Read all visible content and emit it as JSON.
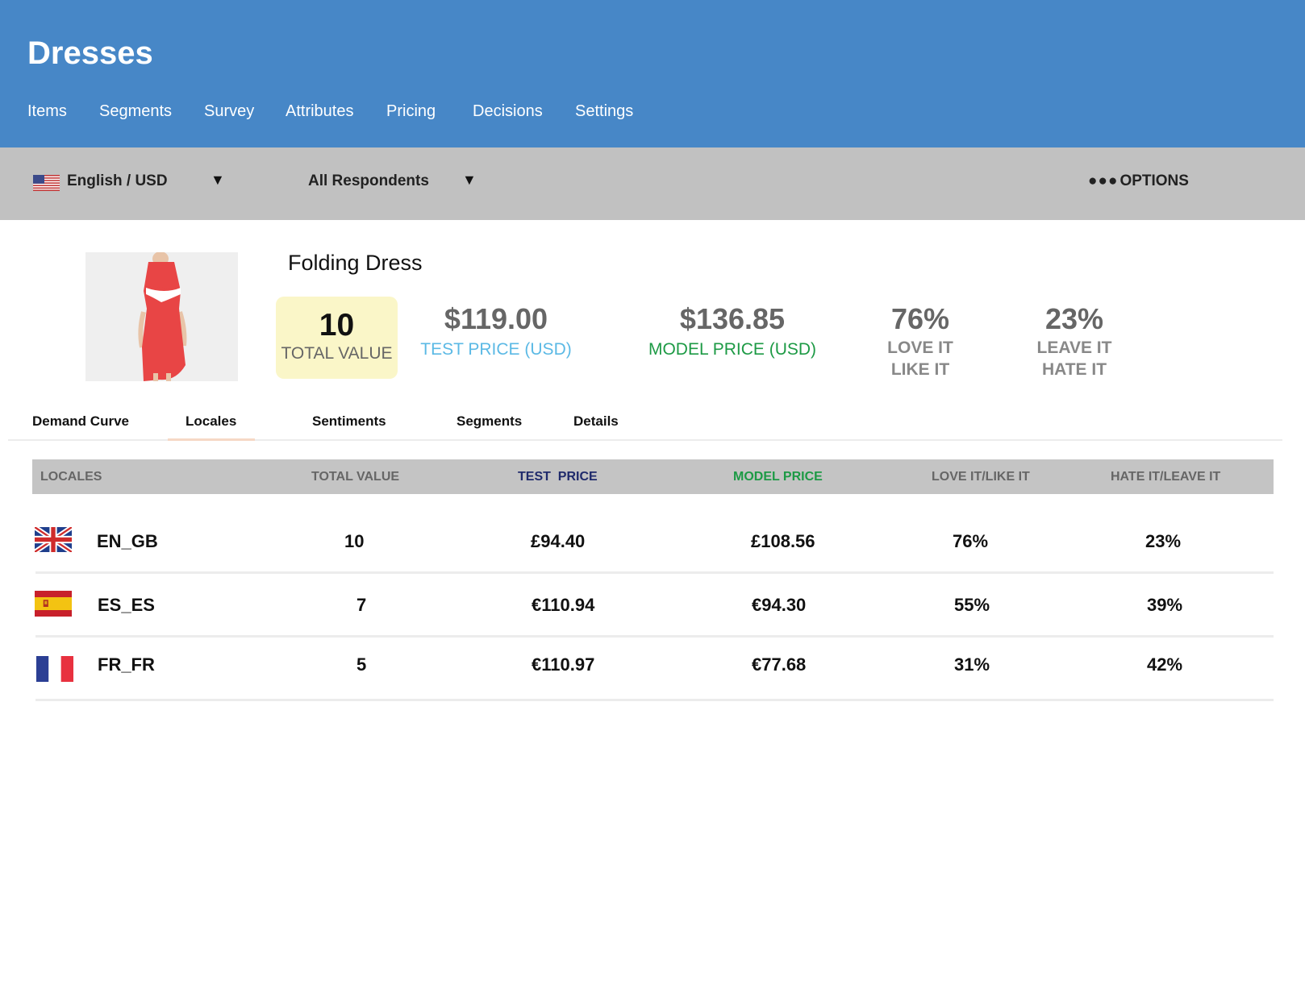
{
  "header": {
    "title": "Dresses",
    "nav": [
      "Items",
      "Segments",
      "Survey",
      "Attributes",
      "Pricing",
      "Decisions",
      "Settings"
    ]
  },
  "filters": {
    "locale_label": "English / USD",
    "respondents_label": "All Respondents",
    "options_dots": "●●●",
    "options_label": "OPTIONS"
  },
  "product": {
    "name": "Folding Dress",
    "total_value": "10",
    "total_value_label": "TOTAL VALUE",
    "test_price": "$119.00",
    "test_price_label": "TEST PRICE (USD)",
    "model_price": "$136.85",
    "model_price_label": "MODEL PRICE (USD)",
    "love_pct": "76%",
    "love_label_1": "LOVE IT",
    "love_label_2": "LIKE IT",
    "leave_pct": "23%",
    "leave_label_1": "LEAVE IT",
    "leave_label_2": "HATE IT"
  },
  "tabs": [
    "Demand Curve",
    "Locales",
    "Sentiments",
    "Segments",
    "Details"
  ],
  "active_tab": "Locales",
  "table": {
    "headers": [
      "LOCALES",
      "TOTAL VALUE",
      "TEST  PRICE",
      "MODEL PRICE",
      "LOVE IT/LIKE IT",
      "HATE IT/LEAVE IT"
    ],
    "rows": [
      {
        "flag": "uk-flag-icon",
        "locale": "EN_GB",
        "total_value": "10",
        "test_price": "£94.40",
        "model_price": "£108.56",
        "love": "76%",
        "hate": "23%"
      },
      {
        "flag": "spain-flag-icon",
        "locale": "ES_ES",
        "total_value": "7",
        "test_price": "€110.94",
        "model_price": "€94.30",
        "love": "55%",
        "hate": "39%"
      },
      {
        "flag": "france-flag-icon",
        "locale": "FR_FR",
        "total_value": "5",
        "test_price": "€110.97",
        "model_price": "€77.68",
        "love": "31%",
        "hate": "42%"
      }
    ]
  },
  "colors": {
    "header_bg": "#4787c7",
    "filter_bg": "#c1c1c1",
    "test_price": "#5bb9e5",
    "model_price": "#1d9a45",
    "total_value_bg": "#faf6c8"
  }
}
